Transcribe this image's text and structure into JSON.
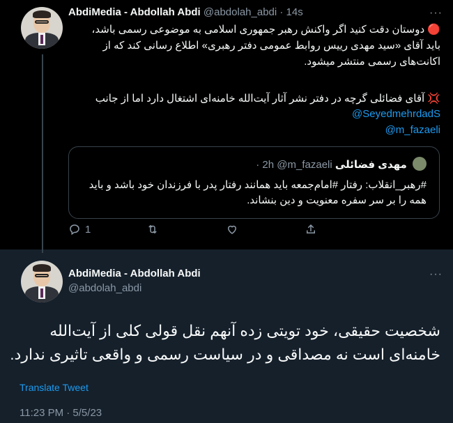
{
  "tweet1": {
    "display_name": "AbdiMedia - Abdollah Abdi",
    "handle": "@abdolah_abdi",
    "time": "· 14s",
    "more": "···",
    "para1": "🔴 دوستان دقت کنید اگر واکنش رهبر جمهوری اسلامی به موضوعی رسمی باشد، باید آقای «سید مهدی رییس روابط عمومی دفتر رهبری» اطلاع رسانی کند که از اکانت‌های رسمی منتشر میشود.",
    "para2": "💢 آقای فضائلی گرچه در دفتر نشر آثار آیت‌الله خامنه‌ای اشتغال دارد اما از جانب",
    "mention1": "@SeyedmehrdadS",
    "mention2": "@m_fazaeli",
    "quote": {
      "name": "مهدی فضائلی",
      "handle": "@m_fazaeli",
      "time": "· 2h",
      "text": "#رهبر_انقلاب: رفتار #امام‌جمعه باید همانند رفتار پدر با فرزندان خود باشد و باید همه را بر سر سفره معنویت و دین بنشاند."
    },
    "actions": {
      "reply_count": "1"
    }
  },
  "tweet2": {
    "display_name": "AbdiMedia - Abdollah Abdi",
    "handle": "@abdolah_abdi",
    "more": "···",
    "text": "شخصیت حقیقی، خود تویتی زده آنهم نقل قولی کلی از آیت‌الله خامنه‌ای است نه مصداقی و در سیاست رسمی و واقعی تاثیری ندارد.",
    "translate": "Translate Tweet",
    "timestamp": "11:23 PM · 5/5/23"
  },
  "icons": [
    "reply-icon",
    "retweet-icon",
    "like-icon",
    "share-icon",
    "more-icon"
  ]
}
